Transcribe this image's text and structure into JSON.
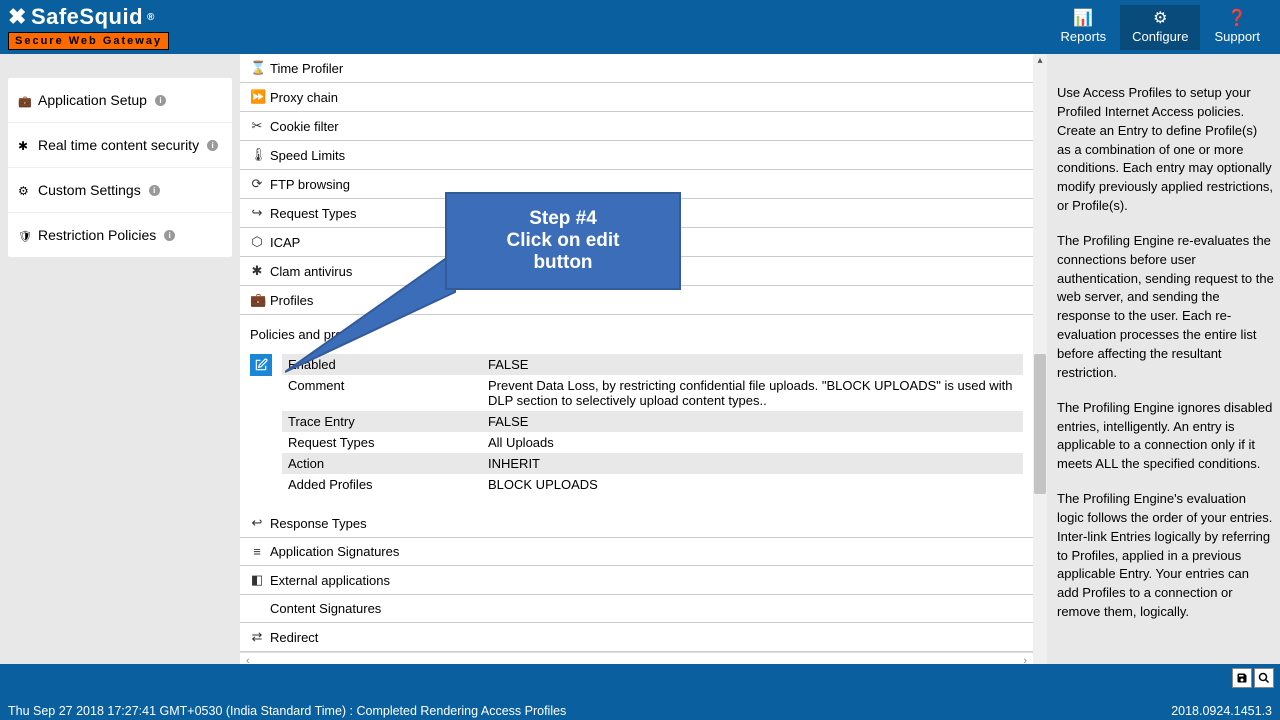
{
  "brand": {
    "name": "SafeSquid",
    "reg": "®",
    "tagline": "Secure Web Gateway"
  },
  "topnav": [
    {
      "icon": "📊",
      "label": "Reports",
      "active": false
    },
    {
      "icon": "⚙",
      "label": "Configure",
      "active": true
    },
    {
      "icon": "❓",
      "label": "Support",
      "active": false
    }
  ],
  "sidebar": {
    "items": [
      {
        "icon": "briefcase",
        "label": "Application Setup"
      },
      {
        "icon": "bug",
        "label": "Real time content security"
      },
      {
        "icon": "sliders",
        "label": "Custom Settings"
      },
      {
        "icon": "shield",
        "label": "Restriction Policies"
      }
    ]
  },
  "accordion": [
    {
      "icon": "⌛",
      "label": "Time Profiler"
    },
    {
      "icon": "⏩",
      "label": "Proxy chain"
    },
    {
      "icon": "✂",
      "label": "Cookie filter"
    },
    {
      "icon": "🌡",
      "label": "Speed Limits"
    },
    {
      "icon": "⟳",
      "label": "FTP browsing"
    },
    {
      "icon": "↪",
      "label": "Request Types"
    },
    {
      "icon": "⬡",
      "label": "ICAP"
    },
    {
      "icon": "✱",
      "label": "Clam antivirus"
    },
    {
      "icon": "💼",
      "label": "Profiles"
    }
  ],
  "profile": {
    "section_label": "Policies and profil",
    "rows": [
      {
        "k": "Enabled",
        "v": "FALSE"
      },
      {
        "k": "Comment",
        "v": "Prevent Data Loss, by restricting confidential file uploads. \"BLOCK UPLOADS\" is used with DLP section to selectively  upload content types.."
      },
      {
        "k": "Trace Entry",
        "v": "FALSE"
      },
      {
        "k": "Request Types",
        "v": "All Uploads"
      },
      {
        "k": "Action",
        "v": "INHERIT"
      },
      {
        "k": "Added Profiles",
        "v": "BLOCK UPLOADS"
      }
    ]
  },
  "accordion_below": [
    {
      "icon": "↩",
      "label": "Response Types"
    },
    {
      "icon": "≡",
      "label": "Application Signatures"
    },
    {
      "icon": "◧",
      "label": "External applications"
    },
    {
      "icon": "",
      "label": "Content Signatures"
    },
    {
      "icon": "⇄",
      "label": "Redirect"
    }
  ],
  "callout": {
    "line1": "Step #4",
    "line2": "Click on edit button"
  },
  "help": {
    "p1": "Use Access Profiles to setup your Profiled Internet Access policies. Create an Entry to define Profile(s) as a combination of one or more conditions. Each entry may optionally modify previously applied restrictions, or Profile(s).",
    "p2": "The Profiling Engine re-evaluates the connections before user authentication, sending request to the web server, and sending the response to the user. Each re-evaluation processes the entire list before affecting the resultant restriction.",
    "p3": "The Profiling Engine ignores disabled entries, intelligently. An entry is applicable to a connection only if it meets ALL the specified conditions.",
    "p4": "The Profiling Engine's evaluation logic follows the order of your entries. Inter-link Entries logically by referring to Profiles, applied in a previous applicable Entry. Your entries can add Profiles to a connection or remove them, logically."
  },
  "footer": {
    "status": "Thu Sep 27 2018 17:27:41 GMT+0530 (India Standard Time) : Completed Rendering Access Profiles",
    "version": "2018.0924.1451.3"
  }
}
